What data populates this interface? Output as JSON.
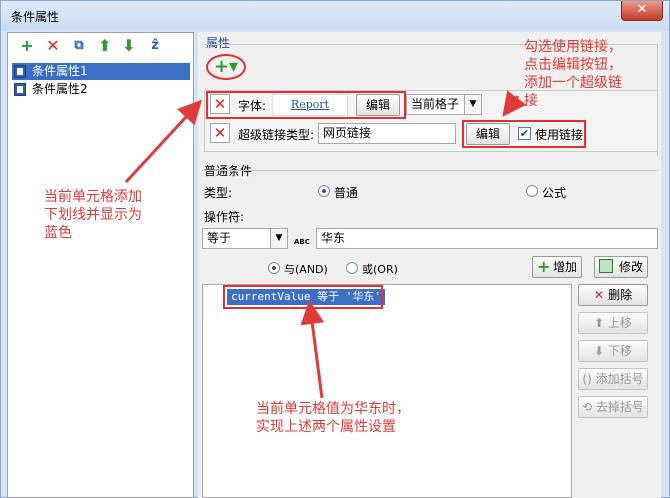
{
  "window": {
    "title": "条件属性",
    "close_glyph": "✕"
  },
  "toolbar": {
    "add": "+",
    "delete": "✕",
    "copy": "⧉",
    "up": "⬆",
    "down": "⬇",
    "sort": "ẑ"
  },
  "tree": [
    {
      "label": "条件属性1",
      "selected": true
    },
    {
      "label": "条件属性2",
      "selected": false
    }
  ],
  "properties": {
    "section_label": "属性",
    "add_glyph": "+▾",
    "row1": {
      "label": "字体:",
      "preview": "Report",
      "edit": "编辑",
      "scope": "当前格子"
    },
    "row2": {
      "label": "超级链接类型:",
      "value": "网页链接",
      "edit": "编辑",
      "checkbox_label": "使用链接"
    }
  },
  "condition": {
    "section_label": "普通条件",
    "type_label": "类型:",
    "type_normal": "普通",
    "type_formula": "公式",
    "operator_label": "操作符:",
    "operator_value": "等于",
    "abc": "ABC",
    "value": "华东",
    "and_label": "与(AND)",
    "or_label": "或(OR)",
    "add_btn": "增加",
    "modify_btn": "修改",
    "expression": "currentValue 等于 '华东'",
    "side_buttons": [
      "删除",
      "上移",
      "下移",
      "添加括号",
      "去掉括号"
    ]
  },
  "annotations": {
    "top_right": [
      "勾选使用链接，",
      "点击编辑按钮，",
      "添加一个超级链",
      "接"
    ],
    "left": [
      "当前单元格添加",
      "下划线并显示为",
      "蓝色"
    ],
    "bottom": [
      "当前单元格值为华东时，",
      "实现上述两个属性设置"
    ]
  },
  "colors": {
    "accent": "#3a6fc4",
    "annotation": "#e03a3a",
    "icon_green": "#2a9d2a",
    "icon_red": "#d22222"
  }
}
